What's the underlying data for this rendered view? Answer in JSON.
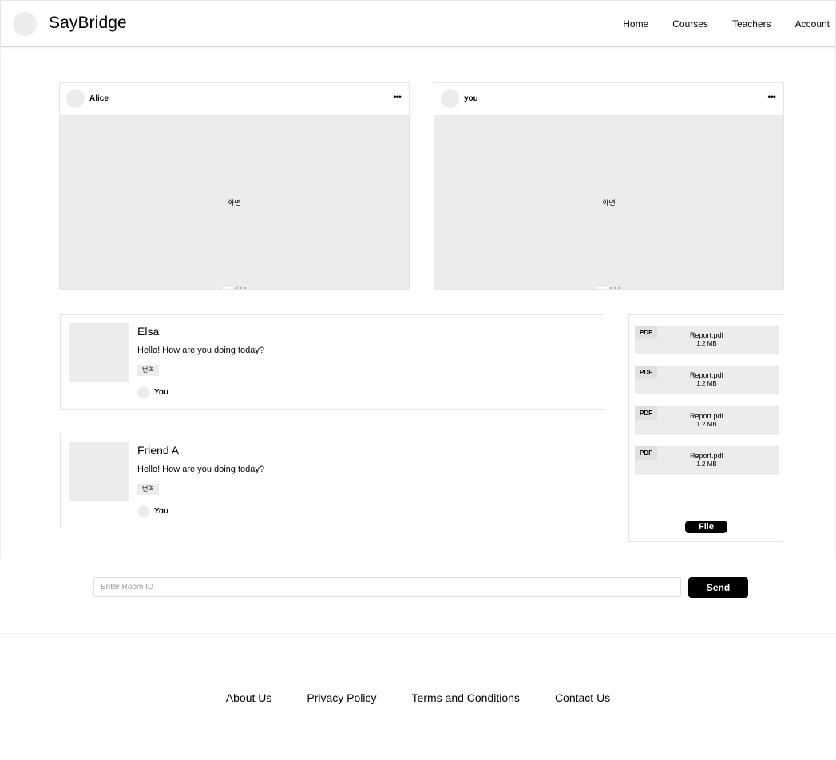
{
  "header": {
    "brand": "SayBridge",
    "nav": [
      "Home",
      "Courses",
      "Teachers",
      "Account"
    ]
  },
  "videos": [
    {
      "name": "Alice",
      "more": "•••",
      "screen_label": "화면"
    },
    {
      "name": "you",
      "more": "•••",
      "screen_label": "화면"
    }
  ],
  "messages": [
    {
      "title": "Elsa",
      "text": "Hello! How are you doing today?",
      "tag": "번역",
      "user": "You"
    },
    {
      "title": "Friend A",
      "text": "Hello! How are you doing today?",
      "tag": "번역",
      "user": "You"
    }
  ],
  "files": {
    "items": [
      {
        "badge": "PDF",
        "name": "Report.pdf",
        "size": "1.2 MB"
      },
      {
        "badge": "PDF",
        "name": "Report.pdf",
        "size": "1.2 MB"
      },
      {
        "badge": "PDF",
        "name": "Report.pdf",
        "size": "1.2 MB"
      },
      {
        "badge": "PDF",
        "name": "Report.pdf",
        "size": "1.2 MB"
      }
    ],
    "button": "File"
  },
  "room": {
    "placeholder": "Enter Room ID",
    "value": "",
    "send_label": "Send"
  },
  "footer": {
    "links": [
      "About Us",
      "Privacy Policy",
      "Terms and Conditions",
      "Contact Us"
    ]
  }
}
